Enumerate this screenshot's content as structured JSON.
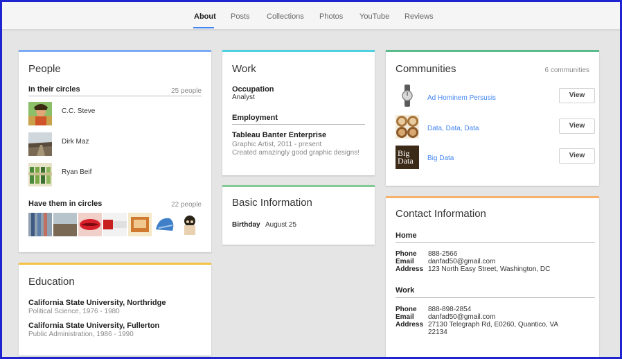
{
  "nav": {
    "tabs": [
      {
        "label": "About",
        "active": true
      },
      {
        "label": "Posts"
      },
      {
        "label": "Collections"
      },
      {
        "label": "Photos"
      },
      {
        "label": "YouTube"
      },
      {
        "label": "Reviews"
      }
    ]
  },
  "people": {
    "title": "People",
    "in_circles_label": "In their circles",
    "in_circles_count": "25 people",
    "circle_people": [
      {
        "name": "C.C. Steve"
      },
      {
        "name": "Dirk Maz"
      },
      {
        "name": "Ryan Beif"
      }
    ],
    "have_them_label": "Have them in circles",
    "have_them_count": "22 people"
  },
  "education": {
    "title": "Education",
    "schools": [
      {
        "name": "California State University, Northridge",
        "detail": "Political Science, 1976 - 1980"
      },
      {
        "name": "California State University, Fullerton",
        "detail": "Public Administration, 1986 - 1990"
      }
    ]
  },
  "work": {
    "title": "Work",
    "occupation_label": "Occupation",
    "occupation_value": "Analyst",
    "employment_label": "Employment",
    "employer": "Tableau Banter Enterprise",
    "role": "Graphic Artist, 2011 - present",
    "description": "Created amazingly good graphic designs!"
  },
  "basic": {
    "title": "Basic Information",
    "birthday_label": "Birthday",
    "birthday_value": "August 25"
  },
  "communities": {
    "title": "Communities",
    "count": "6 communities",
    "items": [
      {
        "name": "Ad Hominem Persusis",
        "button": "View"
      },
      {
        "name": "Data, Data, Data",
        "button": "View"
      },
      {
        "name": "Big Data",
        "button": "View",
        "logo_text": "Big\nData"
      }
    ]
  },
  "contact": {
    "title": "Contact Information",
    "home": {
      "heading": "Home",
      "phone_label": "Phone",
      "phone": "888-2566",
      "email_label": "Email",
      "email": "danfad50@gmail.com",
      "address_label": "Address",
      "address": "123 North Easy Street, Washington, DC"
    },
    "work": {
      "heading": "Work",
      "phone_label": "Phone",
      "phone": "888-898-2854",
      "email_label": "Email",
      "email": "danfad50@gmail.com",
      "address_label": "Address",
      "address_line1": "27130 Telegraph Rd, E0260, Quantico, VA",
      "address_line2": "22134"
    }
  },
  "colors": {
    "people_accent": "#7baaf7",
    "work_accent": "#4dd0e1",
    "communities_accent": "#57bb8a",
    "basic_accent": "#81c995",
    "education_accent": "#f6c344",
    "contact_accent": "#f6b26b",
    "link": "#4285f4",
    "frame": "#1f24d1"
  }
}
